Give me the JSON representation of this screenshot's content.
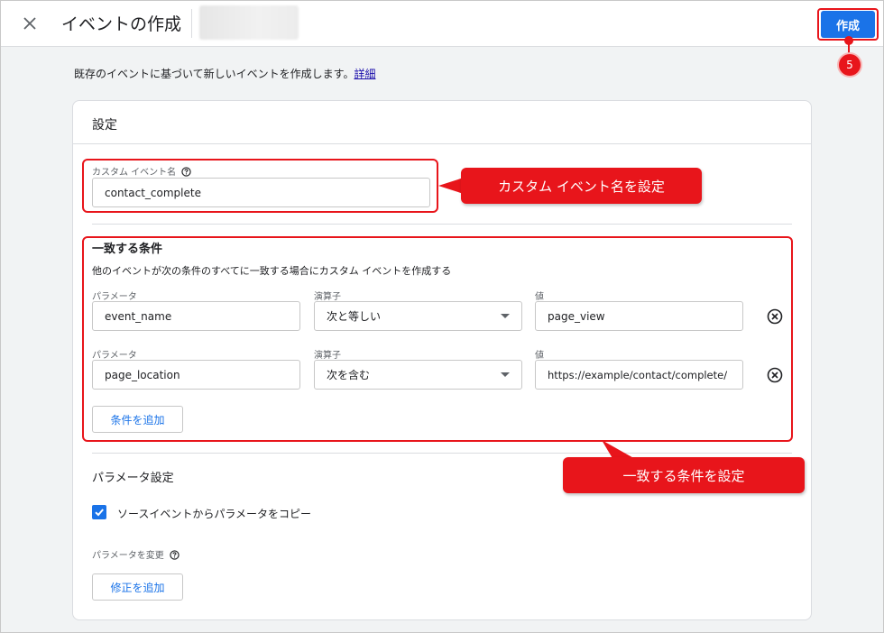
{
  "header": {
    "title": "イベントの作成",
    "create_label": "作成",
    "step_number": "5"
  },
  "description": {
    "text": "既存のイベントに基づいて新しいイベントを作成します。",
    "link": "詳細"
  },
  "settings": {
    "title": "設定",
    "custom_event_name_label": "カスタム イベント名",
    "custom_event_name_value": "contact_complete"
  },
  "conditions": {
    "title": "一致する条件",
    "subtitle": "他のイベントが次の条件のすべてに一致する場合にカスタム イベントを作成する",
    "rows": [
      {
        "param_label": "パラメータ",
        "param_value": "event_name",
        "operator_label": "演算子",
        "operator_value": "次と等しい",
        "value_label": "値",
        "value": "page_view"
      },
      {
        "param_label": "パラメータ",
        "param_value": "page_location",
        "operator_label": "演算子",
        "operator_value": "次を含む",
        "value_label": "値",
        "value": "https://example/contact/complete/"
      }
    ],
    "add_condition_label": "条件を追加"
  },
  "param_settings": {
    "title": "パラメータ設定",
    "copy_checkbox_label": "ソースイベントからパラメータをコピー",
    "copy_checked": true,
    "modify_label": "パラメータを変更",
    "add_modification_label": "修正を追加"
  },
  "annotations": {
    "callout_event_name": "カスタム イベント名を設定",
    "callout_conditions": "一致する条件を設定"
  },
  "colors": {
    "accent": "#1a73e8",
    "annotation_red": "#e8151b"
  }
}
